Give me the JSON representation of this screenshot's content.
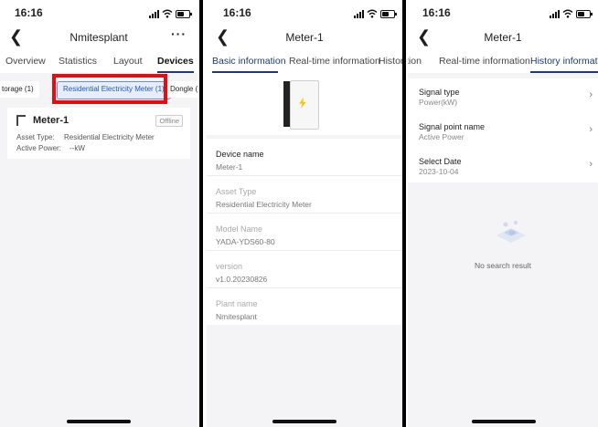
{
  "colors": {
    "accent": "#1f3a6b",
    "highlight": "#e01010",
    "chip_active_bg": "#e6eefc",
    "chip_active_border": "#6a8fd8"
  },
  "screen1": {
    "time": "16:16",
    "title": "Nmitesplant",
    "more": "···",
    "tabs": [
      "Overview",
      "Statistics",
      "Layout",
      "Devices"
    ],
    "active_tab": "Devices",
    "chips": [
      "torage (1)",
      "Residential Electricity Meter (1)",
      "Dongle (2"
    ],
    "active_chip": "Residential Electricity Meter (1)",
    "meter": {
      "name": "Meter-1",
      "status": "Offline",
      "asset_type_label": "Asset Type:",
      "asset_type_value": "Residential Electricity Meter",
      "active_power_label": "Active Power:",
      "active_power_value": "--kW"
    }
  },
  "screen2": {
    "time": "16:16",
    "title": "Meter-1",
    "tabs": [
      "Basic information",
      "Real-time information",
      "Histor"
    ],
    "active_tab": "Basic information",
    "fields": [
      {
        "label": "Device name",
        "value": "Meter-1"
      },
      {
        "label": "Asset Type",
        "value": "Residential Electricity Meter"
      },
      {
        "label": "Model Name",
        "value": "YADA-YDS60-80"
      },
      {
        "label": "version",
        "value": "v1.0.20230826"
      },
      {
        "label": "Plant name",
        "value": "Nmitesplant"
      }
    ]
  },
  "screen3": {
    "time": "16:16",
    "title": "Meter-1",
    "tabs": [
      "tion",
      "Real-time information",
      "History information"
    ],
    "active_tab": "History information",
    "fields": [
      {
        "label": "Signal type",
        "value": "Power(kW)"
      },
      {
        "label": "Signal point name",
        "value": "Active Power"
      },
      {
        "label": "Select Date",
        "value": "2023-10-04"
      }
    ],
    "empty_text": "No search result"
  },
  "icons": {
    "back": "chevron-left-icon",
    "chevron": "chevron-right-icon",
    "signal": "signal-icon",
    "wifi": "wifi-icon",
    "battery": "battery-icon"
  }
}
